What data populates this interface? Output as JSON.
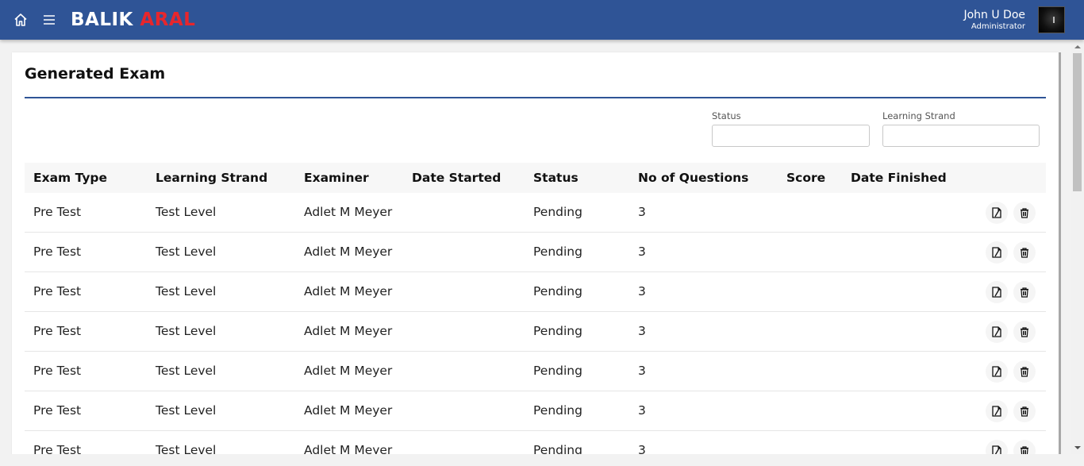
{
  "header": {
    "brand_part1": "BALIK",
    "brand_part2": "ARAL",
    "user_name": "John U Doe",
    "user_role": "Administrator",
    "colors": {
      "bar": "#2f5496",
      "brand_accent": "#e8262c"
    }
  },
  "page": {
    "title": "Generated Exam"
  },
  "filters": {
    "status_label": "Status",
    "status_value": "",
    "strand_label": "Learning Strand",
    "strand_value": ""
  },
  "table": {
    "columns": [
      "Exam Type",
      "Learning Strand",
      "Examiner",
      "Date Started",
      "Status",
      "No of Questions",
      "Score",
      "Date Finished"
    ],
    "rows": [
      [
        "Pre Test",
        "Test Level",
        "Adlet M Meyer",
        "",
        "Pending",
        "3",
        "",
        ""
      ],
      [
        "Pre Test",
        "Test Level",
        "Adlet M Meyer",
        "",
        "Pending",
        "3",
        "",
        ""
      ],
      [
        "Pre Test",
        "Test Level",
        "Adlet M Meyer",
        "",
        "Pending",
        "3",
        "",
        ""
      ],
      [
        "Pre Test",
        "Test Level",
        "Adlet M Meyer",
        "",
        "Pending",
        "3",
        "",
        ""
      ],
      [
        "Pre Test",
        "Test Level",
        "Adlet M Meyer",
        "",
        "Pending",
        "3",
        "",
        ""
      ],
      [
        "Pre Test",
        "Test Level",
        "Adlet M Meyer",
        "",
        "Pending",
        "3",
        "",
        ""
      ],
      [
        "Pre Test",
        "Test Level",
        "Adlet M Meyer",
        "",
        "Pending",
        "3",
        "",
        ""
      ]
    ],
    "row_actions": [
      "edit-icon",
      "delete-icon"
    ]
  },
  "icons": [
    "home-icon",
    "menu-icon",
    "edit-icon",
    "delete-icon",
    "scroll-up-icon",
    "scroll-down-icon"
  ]
}
